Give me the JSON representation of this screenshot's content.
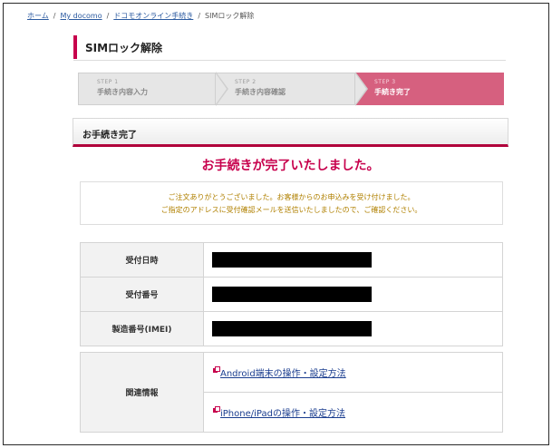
{
  "breadcrumb": {
    "home": "ホーム",
    "my_docomo": "My docomo",
    "online_procedure": "ドコモオンライン手続き",
    "current": "SIMロック解除",
    "separator": "/"
  },
  "page_title": "SIMロック解除",
  "steps": [
    {
      "num": "STEP 1",
      "label": "手続き内容入力",
      "active": false
    },
    {
      "num": "STEP 2",
      "label": "手続き内容確認",
      "active": false
    },
    {
      "num": "STEP 3",
      "label": "手続き完了",
      "active": true
    }
  ],
  "section_title": "お手続き完了",
  "complete_message": "お手続きが完了いたしました。",
  "notice": {
    "line1": "ご注文ありがとうございました。お客様からのお申込みを受け付けました。",
    "line2": "ご指定のアドレスに受付確認メールを送信いたしましたので、ご確認ください。"
  },
  "info_rows": [
    {
      "label": "受付日時"
    },
    {
      "label": "受付番号"
    },
    {
      "label": "製造番号(IMEI)"
    }
  ],
  "related": {
    "label": "関連情報",
    "links": [
      "Android端末の操作・設定方法",
      "iPhone/iPadの操作・設定方法"
    ]
  },
  "colors": {
    "accent": "#c7004c",
    "active_step": "#d6607f",
    "notice_text": "#b08000",
    "link": "#1a3d8f"
  },
  "icons": {
    "external_link": "external-link-icon"
  }
}
